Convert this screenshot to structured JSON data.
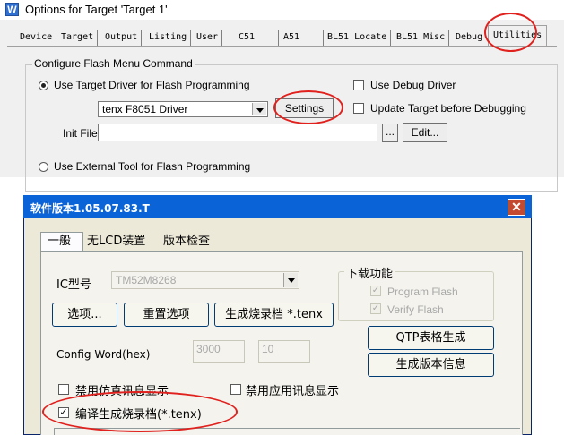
{
  "top_dialog": {
    "title": "Options for Target 'Target 1'",
    "title_icon": "W",
    "tabs": [
      "Device",
      "Target",
      "Output",
      "Listing",
      "User",
      "C51",
      "A51",
      "BL51 Locate",
      "BL51 Misc",
      "Debug",
      "Utilities"
    ],
    "active_tab": "Utilities",
    "group_label": "Configure Flash Menu Command",
    "use_target_driver": "Use Target Driver for Flash Programming",
    "driver_value": "tenx F8051 Driver",
    "settings_button": "Settings",
    "use_debug_driver": "Use Debug Driver",
    "update_target": "Update Target before Debugging",
    "init_file_label": "Init File:",
    "init_file_value": "",
    "browse_button": "...",
    "edit_button": "Edit...",
    "use_external_tool": "Use External Tool for Flash Programming"
  },
  "bottom_dialog": {
    "title": "软件版本1.05.07.83.T",
    "tabs": [
      "一般",
      "无LCD装置",
      "版本检查"
    ],
    "active_tab": "一般",
    "ic_label": "IC型号",
    "ic_value": "TM52M8268",
    "download_group": "下载功能",
    "program_flash": "Program Flash",
    "verify_flash": "Verify Flash",
    "options_button": "选项...",
    "reset_button": "重置选项",
    "gen_burn_button": "生成烧录档 *.tenx",
    "qtp_button": "QTP表格生成",
    "config_word_label": "Config Word(hex)",
    "config_word_value": "3000",
    "config_word_value2": "10",
    "version_info_button": "生成版本信息",
    "disable_sim_msg": "禁用仿真讯息显示",
    "disable_app_msg": "禁用应用讯息显示",
    "compile_gen_burn": "编译生成烧录档(*.tenx)"
  },
  "highlight_color": "#e0211d"
}
